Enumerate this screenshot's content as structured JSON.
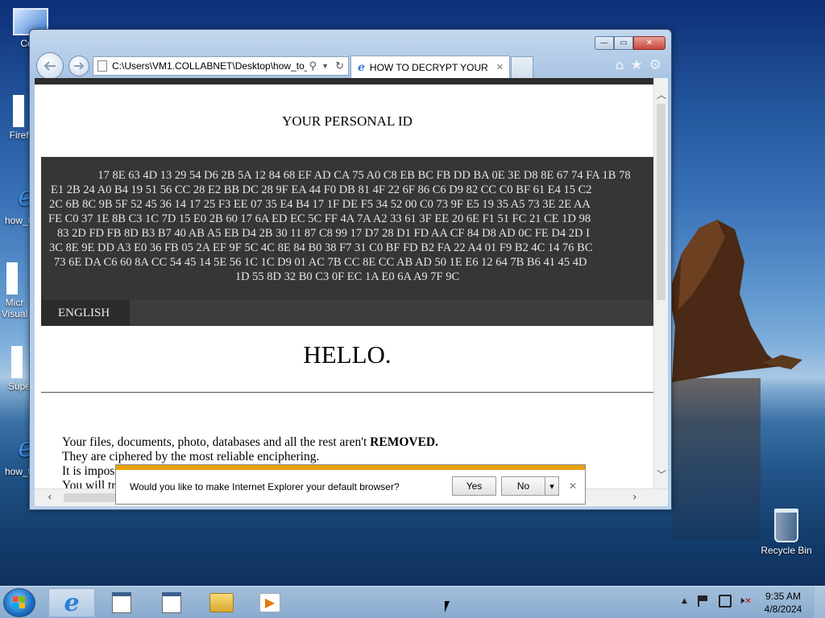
{
  "desktop": {
    "icons": [
      {
        "label": "Com"
      },
      {
        "label": "Firefox"
      },
      {
        "label": "how_t"
      },
      {
        "label": "Micr\nVisual"
      },
      {
        "label": "Supe"
      },
      {
        "label": "how_t"
      }
    ],
    "recycle_bin": {
      "label": "Recycle Bin"
    }
  },
  "browser": {
    "caption_buttons": {
      "minimize": "—",
      "maximize": "▭",
      "close": "✕"
    },
    "address_bar": {
      "value": "C:\\Users\\VM1.COLLABNET\\Desktop\\how_to_"
    },
    "tab": {
      "title": "HOW TO DECRYPT YOUR F...",
      "close": "✕"
    },
    "page": {
      "heading": "YOUR PERSONAL ID",
      "personal_id_lines": [
        "17 8E 63 4D 13 29 54 D6 2B 5A 12 84 68 EF AD CA 75 A0 C8 EB BC FB DD BA 0E 3E D8 8E 67 74 FA 1B 78",
        "E1 2B 24 A0 B4 19 51 56 CC 28 E2 BB DC 28 9F EA 44 F0 DB 81 4F 22 6F 86 C6 D9 82 CC C0 BF 61 E4 15 C2",
        "2C 6B 8C 9B 5F 52 45 36 14 17 25 F3 EE 07 35 E4 B4 17 1F DE F5 34 52 00 C0 73 9F E5 19 35 A5 73 3E 2E AA",
        "FE C0 37 1E 8B C3 1C 7D 15 E0 2B 60 17 6A ED EC 5C FF 4A 7A A2 33 61 3F EE 20 6E F1 51 FC 21 CE 1D 98",
        "83 2D FD FB 8D B3 B7 40 AB A5 EB D4 2B 30 11 87 C8 99 17 D7 28 D1 FD AA CF 84 D8 AD 0C FE D4 2D I",
        "3C 8E 9E DD A3 E0 36 FB 05 2A EF 9F 5C 4C 8E 84 B0 38 F7 31 C0 BF FD B2 FA 22 A4 01 F9 B2 4C 14 76 BC",
        "73 6E DA C6 60 8A CC 54 45 14 5E 56 1C 1C D9 01 AC 7B CC 8E CC AB AD 50 1E E6 12 64 7B B6 41 45 4D",
        "1D 55 8D 32 B0 C3 0F EC 1A E0 6A A9 7F 9C"
      ],
      "language_tab": "ENGLISH",
      "greeting": "HELLO.",
      "para_line1_pre": "Your files, documents, photo, databases and all the rest aren't ",
      "para_line1_bold": "REMOVED.",
      "para_line2": "They are ciphered by the most reliable enciphering.",
      "para_line3": "It is impos",
      "para_line4": "You will tr"
    },
    "notification": {
      "text": "Would you like to make Internet Explorer your default browser?",
      "yes": "Yes",
      "no": "No",
      "dropdown": "▾",
      "close": "✕"
    }
  },
  "taskbar": {
    "clock_time": "9:35 AM",
    "clock_date": "4/8/2024",
    "tray_chevron": "▲"
  },
  "colors": {
    "accent": "#1e5799",
    "notif_stripe": "#e8a20c",
    "page_dark": "#333333"
  }
}
